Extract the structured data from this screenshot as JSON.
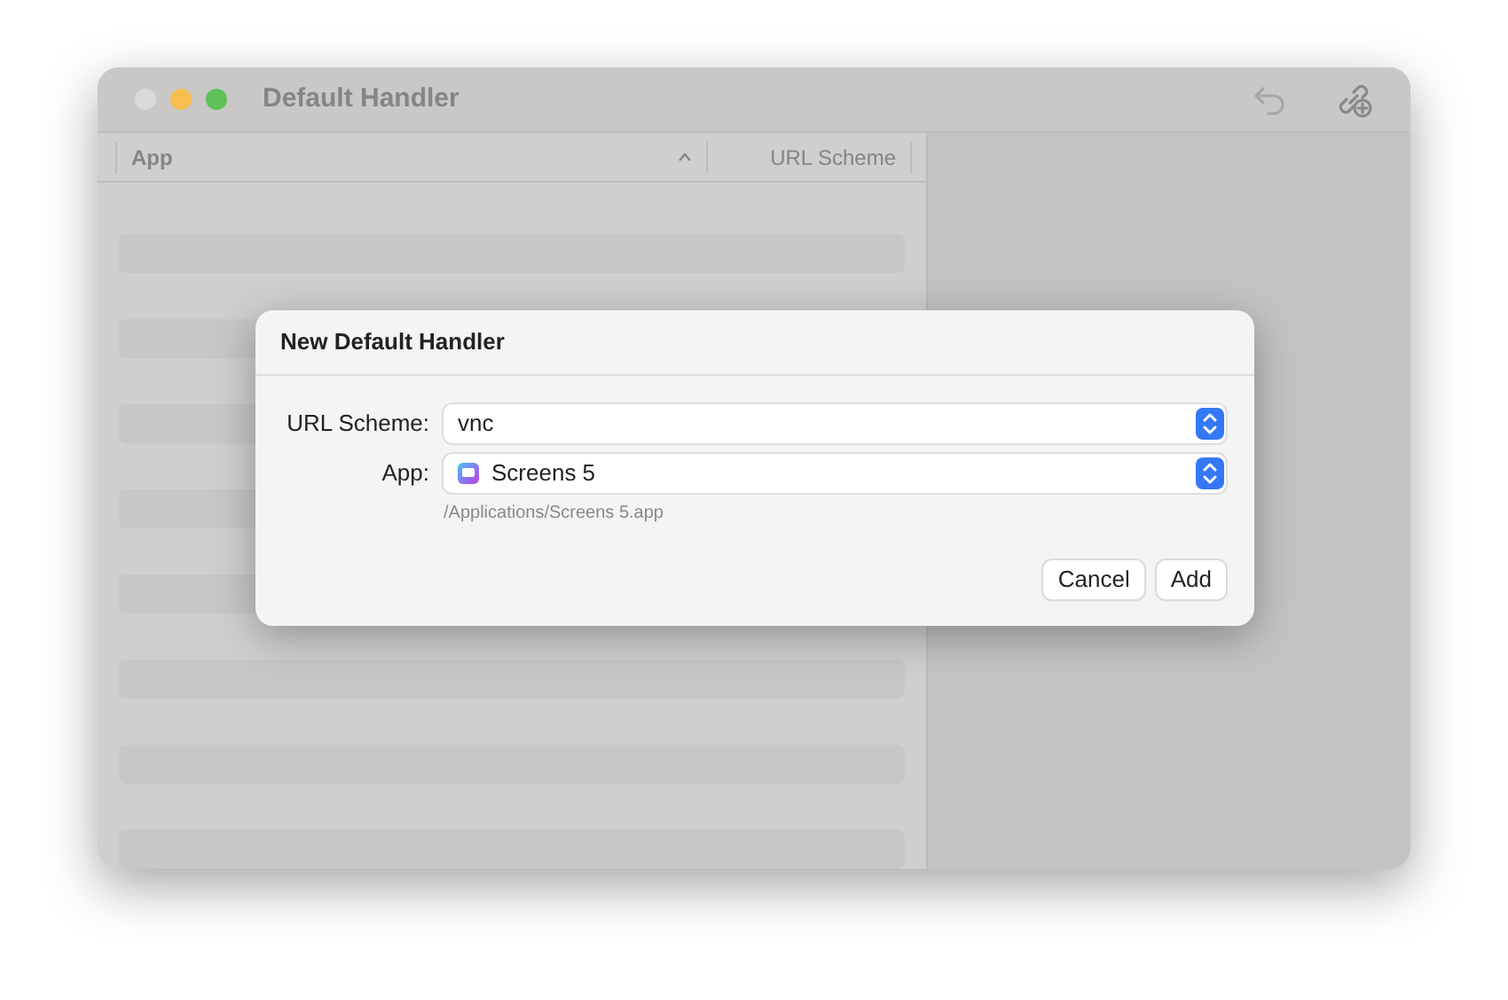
{
  "window": {
    "title": "Default Handler"
  },
  "table": {
    "columns": [
      {
        "label": "App",
        "sorted": true
      },
      {
        "label": "URL Scheme",
        "sorted": false
      }
    ]
  },
  "dialog": {
    "title": "New Default Handler",
    "fields": [
      {
        "label": "URL Scheme:",
        "value": "vnc",
        "kind": "text"
      },
      {
        "label": "App:",
        "value": "Screens 5",
        "kind": "app",
        "note": "/Applications/Screens 5.app"
      }
    ],
    "buttons": [
      "Cancel",
      "Add"
    ]
  }
}
